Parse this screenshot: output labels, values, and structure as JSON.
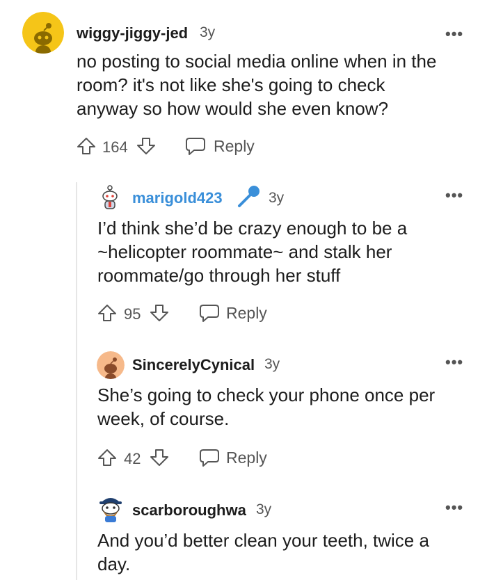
{
  "comments": [
    {
      "username": "wiggy-jiggy-jed",
      "time": "3y",
      "body": [
        "no posting to social media online when in the",
        "room? it's not like she's going to check",
        "anyway so how would she even know?"
      ],
      "score": "164",
      "reply": "Reply",
      "more": "•••",
      "avatar_color": "#f5c518"
    },
    {
      "username": "marigold423",
      "time": "3y",
      "body": [
        "I’d think she’d be crazy enough to be a",
        "~helicopter roommate~ and stalk her",
        "roommate/go through her stuff"
      ],
      "score": "95",
      "reply": "Reply",
      "more": "•••",
      "username_color": "#3a8fd9"
    },
    {
      "username": "SincerelyCynical",
      "time": "3y",
      "body": [
        "She’s going to check your phone once per",
        "week, of course."
      ],
      "score": "42",
      "reply": "Reply",
      "more": "•••",
      "avatar_color": "#f6b98a"
    },
    {
      "username": "scarboroughwa",
      "time": "3y",
      "body": [
        "And you’d better clean your teeth, twice a",
        "day."
      ],
      "more": "•••"
    }
  ]
}
